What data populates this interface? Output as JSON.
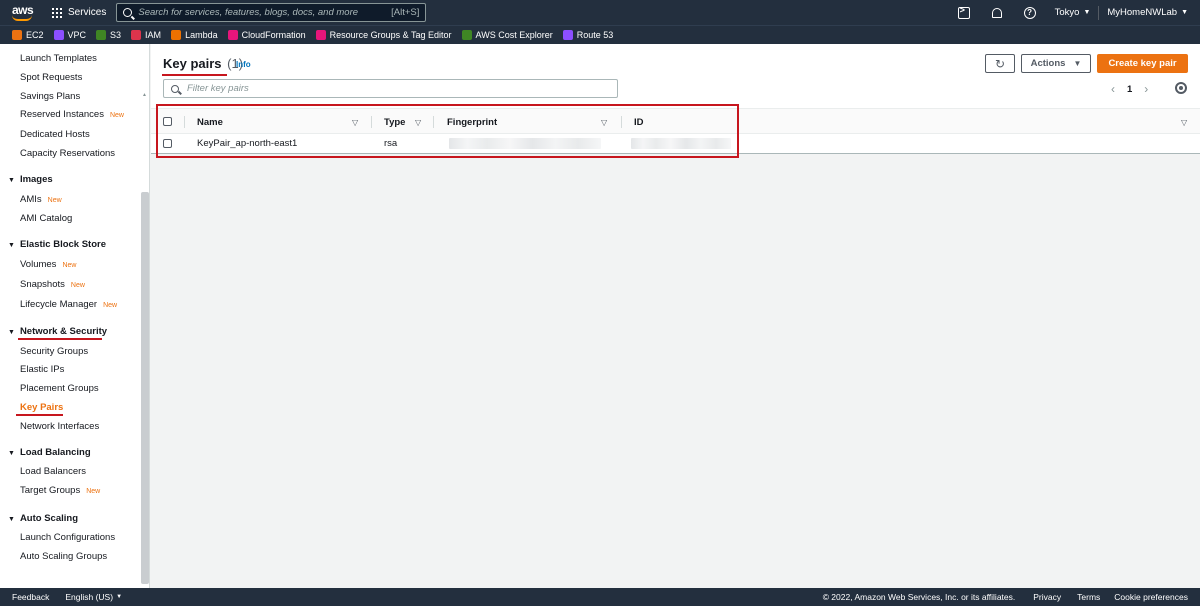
{
  "topnav": {
    "logo_text": "aws",
    "services_label": "Services",
    "search_placeholder": "Search for services, features, blogs, docs, and more",
    "search_shortcut": "[Alt+S]",
    "region": "Tokyo",
    "account": "MyHomeNWLab"
  },
  "favorites": [
    {
      "label": "EC2",
      "color": "#ec7211"
    },
    {
      "label": "VPC",
      "color": "#8c4fff"
    },
    {
      "label": "S3",
      "color": "#3f8624"
    },
    {
      "label": "IAM",
      "color": "#dd344c"
    },
    {
      "label": "Lambda",
      "color": "#ed7100"
    },
    {
      "label": "CloudFormation",
      "color": "#e7157b"
    },
    {
      "label": "Resource Groups & Tag Editor",
      "color": "#e7157b"
    },
    {
      "label": "AWS Cost Explorer",
      "color": "#3f8624"
    },
    {
      "label": "Route 53",
      "color": "#8c4fff"
    }
  ],
  "sidebar": {
    "new_badge": "New",
    "items_top": [
      "Launch Templates",
      "Spot Requests",
      "Savings Plans",
      "Reserved Instances",
      "Dedicated Hosts",
      "Capacity Reservations"
    ],
    "images": {
      "head": "Images",
      "items": [
        "AMIs",
        "AMI Catalog"
      ]
    },
    "ebs": {
      "head": "Elastic Block Store",
      "items": [
        "Volumes",
        "Snapshots",
        "Lifecycle Manager"
      ]
    },
    "network": {
      "head": "Network & Security",
      "items": [
        "Security Groups",
        "Elastic IPs",
        "Placement Groups",
        "Key Pairs",
        "Network Interfaces"
      ]
    },
    "lb": {
      "head": "Load Balancing",
      "items": [
        "Load Balancers",
        "Target Groups"
      ]
    },
    "as": {
      "head": "Auto Scaling",
      "items": [
        "Launch Configurations",
        "Auto Scaling Groups"
      ]
    }
  },
  "main": {
    "title": "Key pairs",
    "count": "(1)",
    "info": "Info",
    "actions_label": "Actions",
    "create_label": "Create key pair",
    "filter_placeholder": "Filter key pairs",
    "page": "1",
    "columns": [
      "Name",
      "Type",
      "Fingerprint",
      "ID"
    ],
    "rows": [
      {
        "name": "KeyPair_ap-north-east1",
        "type": "rsa"
      }
    ]
  },
  "footer": {
    "feedback": "Feedback",
    "language": "English (US)",
    "copyright": "© 2022, Amazon Web Services, Inc. or its affiliates.",
    "privacy": "Privacy",
    "terms": "Terms",
    "cookie": "Cookie preferences"
  }
}
